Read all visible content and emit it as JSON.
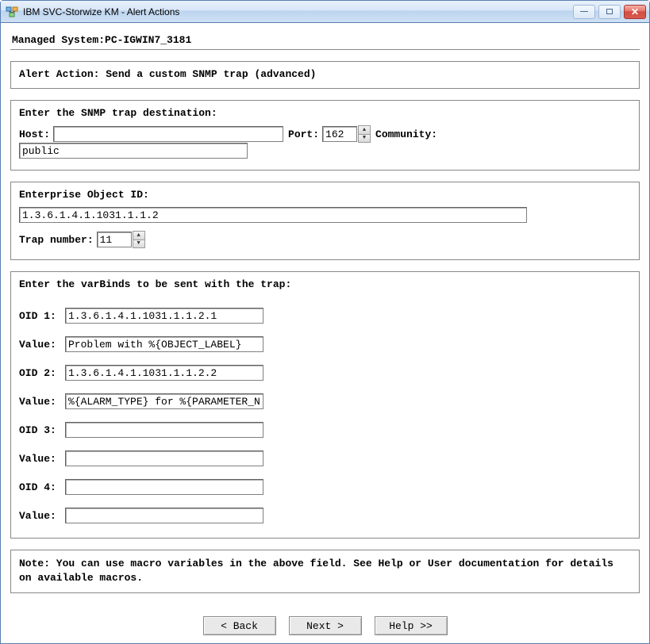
{
  "window": {
    "title": "IBM SVC-Storwize KM - Alert Actions"
  },
  "header": {
    "managed_system_label": "Managed System:",
    "managed_system_value": "PC-IGWIN7_3181"
  },
  "alert_action": {
    "label": "Alert Action: ",
    "value": "Send a custom SNMP trap (advanced)"
  },
  "snmp_dest": {
    "title": "Enter the SNMP trap destination:",
    "host_label": "Host:",
    "host_value": "",
    "port_label": "Port:",
    "port_value": "162",
    "community_label": "Community:",
    "community_value": "public"
  },
  "enterprise": {
    "oid_label": "Enterprise Object ID:",
    "oid_value": "1.3.6.1.4.1.1031.1.1.2",
    "trap_label": "Trap number:",
    "trap_value": "11"
  },
  "varbinds": {
    "title": "Enter the varBinds to be sent with the trap:",
    "oid1_label": "OID 1:",
    "oid1_value": "1.3.6.1.4.1.1031.1.1.2.1",
    "val1_label": "Value:",
    "val1_value": "Problem with %{OBJECT_LABEL}",
    "oid2_label": "OID 2:",
    "oid2_value": "1.3.6.1.4.1.1031.1.1.2.2",
    "val2_label": "Value:",
    "val2_value": "%{ALARM_TYPE} for %{PARAMETER_N",
    "oid3_label": "OID 3:",
    "oid3_value": "",
    "val3_label": "Value:",
    "val3_value": "",
    "oid4_label": "OID 4:",
    "oid4_value": "",
    "val4_label": "Value:",
    "val4_value": ""
  },
  "note": {
    "text": "Note: You can use macro variables in the above field. See Help or User documentation for details on available macros."
  },
  "footer": {
    "back": "< Back",
    "next": "Next >",
    "help": "Help >>"
  }
}
